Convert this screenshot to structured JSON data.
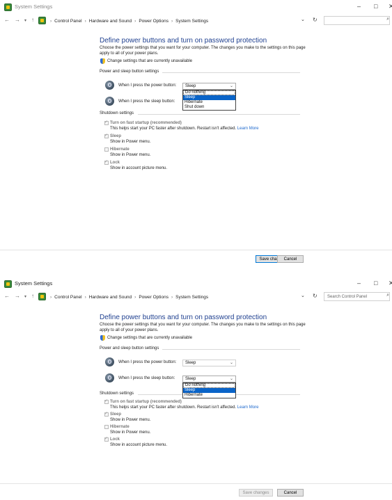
{
  "panels": [
    {
      "title": "System Settings",
      "window_controls": {
        "minimize": "–",
        "maximize": "□",
        "close": "✕"
      },
      "nav": {
        "back": "←",
        "forward": "→",
        "recent": "▾",
        "up": "↑"
      },
      "breadcrumb": [
        "Control Panel",
        "Hardware and Sound",
        "Power Options",
        "System Settings"
      ],
      "address_chevron": "⌄",
      "refresh": "↻",
      "search": {
        "placeholder": "",
        "icon": "search-icon"
      },
      "heading": "Define power buttons and turn on password protection",
      "description": "Choose the power settings that you want for your computer. The changes you make to the settings on this page apply to all of your power plans.",
      "change_link": "Change settings that are currently unavailable",
      "power_sleep_section": "Power and sleep button settings",
      "power_button_label": "When I press the power button:",
      "power_button_value": "Sleep",
      "sleep_button_label": "When I press the sleep button:",
      "power_dropdown_options": [
        "Do nothing",
        "Sleep",
        "Hibernate",
        "Shut down"
      ],
      "power_dropdown_selected": "Sleep",
      "shutdown_section": "Shutdown settings",
      "shutdown_options": [
        {
          "title": "Turn on fast startup (recommended)",
          "desc": "This helps start your PC faster after shutdown. Restart isn't affected.",
          "link": "Learn More",
          "checked": true
        },
        {
          "title": "Sleep",
          "desc": "Show in Power menu.",
          "checked": true
        },
        {
          "title": "Hibernate",
          "desc": "Show in Power menu.",
          "checked": false
        },
        {
          "title": "Lock",
          "desc": "Show in account picture menu.",
          "checked": true
        }
      ],
      "save_label": "Save changes",
      "cancel_label": "Cancel"
    },
    {
      "title": "System Settings",
      "window_controls": {
        "minimize": "–",
        "maximize": "□",
        "close": "✕"
      },
      "nav": {
        "back": "←",
        "forward": "→",
        "recent": "▾",
        "up": "↑"
      },
      "breadcrumb": [
        "Control Panel",
        "Hardware and Sound",
        "Power Options",
        "System Settings"
      ],
      "address_chevron": "⌄",
      "refresh": "↻",
      "search": {
        "placeholder": "Search Control Panel",
        "icon": "search-icon"
      },
      "heading": "Define power buttons and turn on password protection",
      "description": "Choose the power settings that you want for your computer. The changes you make to the settings on this page apply to all of your power plans.",
      "change_link": "Change settings that are currently unavailable",
      "power_sleep_section": "Power and sleep button settings",
      "power_button_label": "When I press the power button:",
      "power_button_value": "Sleep",
      "sleep_button_label": "When I press the sleep button:",
      "sleep_button_value": "Sleep",
      "sleep_dropdown_options": [
        "Do nothing",
        "Sleep",
        "Hibernate"
      ],
      "sleep_dropdown_selected": "Sleep",
      "shutdown_section": "Shutdown settings",
      "shutdown_options": [
        {
          "title": "Turn on fast startup (recommended)",
          "desc": "This helps start your PC faster after shutdown. Restart isn't affected.",
          "link": "Learn More",
          "checked": true
        },
        {
          "title": "Sleep",
          "desc": "Show in Power menu.",
          "checked": true
        },
        {
          "title": "Hibernate",
          "desc": "Show in Power menu.",
          "checked": false
        },
        {
          "title": "Lock",
          "desc": "Show in account picture menu.",
          "checked": true
        }
      ],
      "save_label": "Save changes",
      "cancel_label": "Cancel"
    }
  ]
}
